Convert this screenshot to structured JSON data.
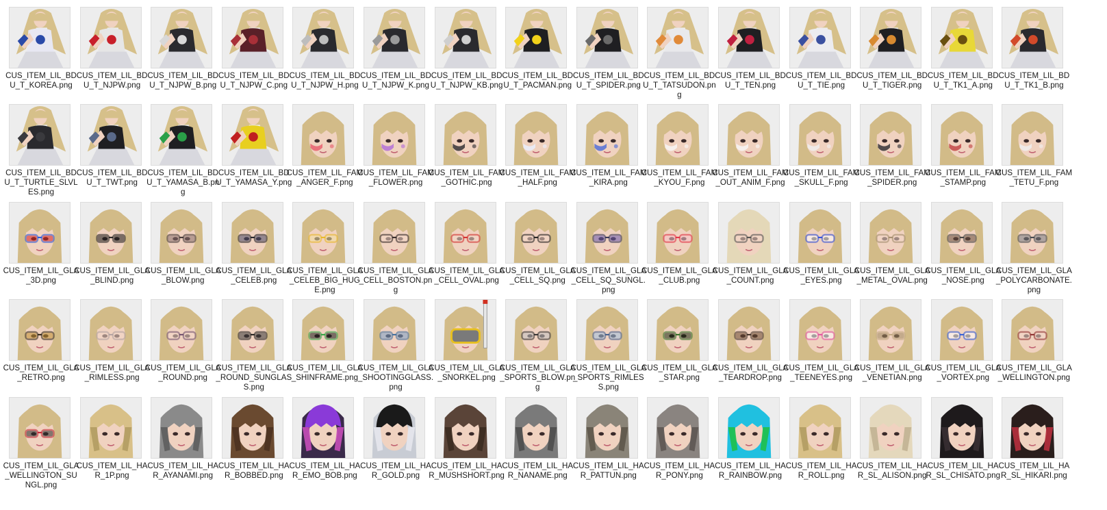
{
  "files": [
    {
      "name": "CUS_ITEM_LIL_BDU_T_KOREA.png",
      "preview": "body",
      "hair": "#d6c08a",
      "item": "#e8e8f2",
      "accent": "#2a4aa8"
    },
    {
      "name": "CUS_ITEM_LIL_BDU_T_NJPW.png",
      "preview": "body",
      "hair": "#d6c08a",
      "item": "#e6e6e6",
      "accent": "#c8202a"
    },
    {
      "name": "CUS_ITEM_LIL_BDU_T_NJPW_B.png",
      "preview": "body",
      "hair": "#d6c08a",
      "item": "#2a2a2e",
      "accent": "#d8d8d8"
    },
    {
      "name": "CUS_ITEM_LIL_BDU_T_NJPW_C.png",
      "preview": "body",
      "hair": "#d6c08a",
      "item": "#5a2028",
      "accent": "#a83038"
    },
    {
      "name": "CUS_ITEM_LIL_BDU_T_NJPW_H.png",
      "preview": "body",
      "hair": "#d6c08a",
      "item": "#2a2a2e",
      "accent": "#bdbdbd"
    },
    {
      "name": "CUS_ITEM_LIL_BDU_T_NJPW_K.png",
      "preview": "body",
      "hair": "#d6c08a",
      "item": "#2a2a2e",
      "accent": "#9a9a9a"
    },
    {
      "name": "CUS_ITEM_LIL_BDU_T_NJPW_KB.png",
      "preview": "body",
      "hair": "#d6c08a",
      "item": "#2a2a2e",
      "accent": "#cfcfcf"
    },
    {
      "name": "CUS_ITEM_LIL_BDU_T_PACMAN.png",
      "preview": "body",
      "hair": "#d6c08a",
      "item": "#1f1f22",
      "accent": "#f2d21a"
    },
    {
      "name": "CUS_ITEM_LIL_BDU_T_SPIDER.png",
      "preview": "body",
      "hair": "#d6c08a",
      "item": "#1f1f22",
      "accent": "#6a6a6a"
    },
    {
      "name": "CUS_ITEM_LIL_BDU_T_TATSUDON.png",
      "preview": "body",
      "hair": "#d6c08a",
      "item": "#e9e9ec",
      "accent": "#e08a3a"
    },
    {
      "name": "CUS_ITEM_LIL_BDU_T_TEN.png",
      "preview": "body",
      "hair": "#d6c08a",
      "item": "#1f1f22",
      "accent": "#c02040"
    },
    {
      "name": "CUS_ITEM_LIL_BDU_T_TIE.png",
      "preview": "body",
      "hair": "#d6c08a",
      "item": "#ececf0",
      "accent": "#3a50a0"
    },
    {
      "name": "CUS_ITEM_LIL_BDU_T_TIGER.png",
      "preview": "body",
      "hair": "#d6c08a",
      "item": "#1f1f22",
      "accent": "#d88a30"
    },
    {
      "name": "CUS_ITEM_LIL_BDU_T_TK1_A.png",
      "preview": "body",
      "hair": "#d6c08a",
      "item": "#e8d838",
      "accent": "#6a5010"
    },
    {
      "name": "CUS_ITEM_LIL_BDU_T_TK1_B.png",
      "preview": "body",
      "hair": "#d6c08a",
      "item": "#2a2a2e",
      "accent": "#d24a2a"
    },
    {
      "name": "CUS_ITEM_LIL_BDU_T_TURTLE_SLVLES.png",
      "preview": "body",
      "hair": "#d6c08a",
      "item": "#2a2a2e",
      "accent": "#3a3a3e"
    },
    {
      "name": "CUS_ITEM_LIL_BDU_T_TWT.png",
      "preview": "body",
      "hair": "#d6c08a",
      "item": "#1f1f22",
      "accent": "#5a6a8a"
    },
    {
      "name": "CUS_ITEM_LIL_BDU_T_YAMASA_B.png",
      "preview": "body",
      "hair": "#d6c08a",
      "item": "#1f1f22",
      "accent": "#2aa048"
    },
    {
      "name": "CUS_ITEM_LIL_BDU_T_YAMASA_Y.png",
      "preview": "body",
      "hair": "#d6c08a",
      "item": "#e8cf20",
      "accent": "#c02020"
    },
    {
      "name": "CUS_ITEM_LIL_FAM_ANGER_F.png",
      "preview": "face",
      "hair": "#d2bb88",
      "item": "#e85a6a",
      "accent": "#f2d6c8"
    },
    {
      "name": "CUS_ITEM_LIL_FAM_FLOWER.png",
      "preview": "face",
      "hair": "#d2bb88",
      "item": "#b06ad8",
      "accent": "#f2d6c8"
    },
    {
      "name": "CUS_ITEM_LIL_FAM_GOTHIC.png",
      "preview": "face",
      "hair": "#d2bb88",
      "item": "#2a2a30",
      "accent": "#f4e8ec"
    },
    {
      "name": "CUS_ITEM_LIL_FAM_HALF.png",
      "preview": "face",
      "hair": "#d2bb88",
      "item": "#e8f0ff",
      "accent": "#4a9ad8"
    },
    {
      "name": "CUS_ITEM_LIL_FAM_KIRA.png",
      "preview": "face",
      "hair": "#d2bb88",
      "item": "#4a6ad8",
      "accent": "#f2d6c8"
    },
    {
      "name": "CUS_ITEM_LIL_FAM_KYOU_F.png",
      "preview": "face",
      "hair": "#d2bb88",
      "item": "#f8f8f8",
      "accent": "#d02030"
    },
    {
      "name": "CUS_ITEM_LIL_FAM_OUT_ANIM_F.png",
      "preview": "face",
      "hair": "#d2bb88",
      "item": "#f8f8f8",
      "accent": "#d03040"
    },
    {
      "name": "CUS_ITEM_LIL_FAM_SKULL_F.png",
      "preview": "face",
      "hair": "#d2bb88",
      "item": "#f0f0f0",
      "accent": "#1a1a1a"
    },
    {
      "name": "CUS_ITEM_LIL_FAM_SPIDER.png",
      "preview": "face",
      "hair": "#d2bb88",
      "item": "#2a2a30",
      "accent": "#f2d6c8"
    },
    {
      "name": "CUS_ITEM_LIL_FAM_STAMP.png",
      "preview": "face",
      "hair": "#d2bb88",
      "item": "#c04040",
      "accent": "#f2d6c8"
    },
    {
      "name": "CUS_ITEM_LIL_FAM_TETU_F.png",
      "preview": "face",
      "hair": "#d2bb88",
      "item": "#f0f0f0",
      "accent": "#e07080"
    },
    {
      "name": "CUS_ITEM_LIL_GLA_3D.png",
      "preview": "glasses",
      "hair": "#d2bb88",
      "item": "#2050d8",
      "accent": "#d82020"
    },
    {
      "name": "CUS_ITEM_LIL_GLA_BLIND.png",
      "preview": "glasses",
      "hair": "#d2bb88",
      "item": "#1a1a1a",
      "accent": "#1a1a1a"
    },
    {
      "name": "CUS_ITEM_LIL_GLA_BLOW.png",
      "preview": "glasses",
      "hair": "#d2bb88",
      "item": "#3a3030",
      "accent": "#8a7070"
    },
    {
      "name": "CUS_ITEM_LIL_GLA_CELEB.png",
      "preview": "glasses",
      "hair": "#d2bb88",
      "item": "#1a1a22",
      "accent": "#4a4a6a"
    },
    {
      "name": "CUS_ITEM_LIL_GLA_CELEB_BIG_HUGE.png",
      "preview": "glasses",
      "hair": "#d2bb88",
      "item": "#e8b820",
      "accent": "#f2e0a0"
    },
    {
      "name": "CUS_ITEM_LIL_GLA_CELL_BOSTON.png",
      "preview": "glasses",
      "hair": "#d2bb88",
      "item": "#2a2020",
      "accent": "#f2d6c8"
    },
    {
      "name": "CUS_ITEM_LIL_GLA_CELL_OVAL.png",
      "preview": "glasses",
      "hair": "#d2bb88",
      "item": "#d02a2a",
      "accent": "#f2d6c8"
    },
    {
      "name": "CUS_ITEM_LIL_GLA_CELL_SQ.png",
      "preview": "glasses",
      "hair": "#d2bb88",
      "item": "#1a1a1a",
      "accent": "#f2d6c8"
    },
    {
      "name": "CUS_ITEM_LIL_GLA_CELL_SQ_SUNGL.png",
      "preview": "glasses",
      "hair": "#d2bb88",
      "item": "#2a2a50",
      "accent": "#6a5ab0"
    },
    {
      "name": "CUS_ITEM_LIL_GLA_CLUB.png",
      "preview": "glasses",
      "hair": "#d2bb88",
      "item": "#e02a40",
      "accent": "#f8c0c8"
    },
    {
      "name": "CUS_ITEM_LIL_GLA_COUNT.png",
      "preview": "glasses",
      "hair": "#e4d8b8",
      "item": "#4a4a4a",
      "accent": "#f2d6c8"
    },
    {
      "name": "CUS_ITEM_LIL_GLA_EYES.png",
      "preview": "glasses",
      "hair": "#d2bb88",
      "item": "#2a4ad8",
      "accent": "#ffffff"
    },
    {
      "name": "CUS_ITEM_LIL_GLA_METAL_OVAL.png",
      "preview": "glasses",
      "hair": "#d2bb88",
      "item": "#a08a6a",
      "accent": "#f2d6c8"
    },
    {
      "name": "CUS_ITEM_LIL_GLA_NOSE.png",
      "preview": "glasses",
      "hair": "#d2bb88",
      "item": "#3a3a3a",
      "accent": "#6a5040"
    },
    {
      "name": "CUS_ITEM_LIL_GLA_POLYCARBONATE.png",
      "preview": "glasses",
      "hair": "#d2bb88",
      "item": "#3a4048",
      "accent": "#7a8088"
    },
    {
      "name": "CUS_ITEM_LIL_GLA_RETRO.png",
      "preview": "glasses",
      "hair": "#d2bb88",
      "item": "#2a2010",
      "accent": "#c09030"
    },
    {
      "name": "CUS_ITEM_LIL_GLA_RIMLESS.png",
      "preview": "glasses",
      "hair": "#d2bb88",
      "item": "#b0a0a0",
      "accent": "#f2d6c8"
    },
    {
      "name": "CUS_ITEM_LIL_GLA_ROUND.png",
      "preview": "glasses",
      "hair": "#d2bb88",
      "item": "#6a4a6a",
      "accent": "#f2d6c8"
    },
    {
      "name": "CUS_ITEM_LIL_GLA_ROUND_SUNGLASS.png",
      "preview": "glasses",
      "hair": "#d2bb88",
      "item": "#1a1a1a",
      "accent": "#3a3a3a"
    },
    {
      "name": "CUS_ITEM_LIL_GLA_SHINFRAME.png",
      "preview": "glasses",
      "hair": "#d2bb88",
      "item": "#2aa040",
      "accent": "#1a1a1a"
    },
    {
      "name": "CUS_ITEM_LIL_GLA_SHOOTINGGLASS.png",
      "preview": "glasses",
      "hair": "#d2bb88",
      "item": "#3a6a9a",
      "accent": "#7aa0c8"
    },
    {
      "name": "CUS_ITEM_LIL_GLA_SNORKEL.png",
      "preview": "snorkel",
      "hair": "#d2bb88",
      "item": "#e8c020",
      "accent": "#d03020"
    },
    {
      "name": "CUS_ITEM_LIL_GLA_SPORTS_BLOW.png",
      "preview": "glasses",
      "hair": "#d2bb88",
      "item": "#2a2a2a",
      "accent": "#c0c0c0"
    },
    {
      "name": "CUS_ITEM_LIL_GLA_SPORTS_RIMLESS.png",
      "preview": "glasses",
      "hair": "#d2bb88",
      "item": "#3a5a8a",
      "accent": "#a0c0e0"
    },
    {
      "name": "CUS_ITEM_LIL_GLA_STAR.png",
      "preview": "glasses",
      "hair": "#d2bb88",
      "item": "#2a6a20",
      "accent": "#1a2a10"
    },
    {
      "name": "CUS_ITEM_LIL_GLA_TEARDROP.png",
      "preview": "glasses",
      "hair": "#d2bb88",
      "item": "#3a2a20",
      "accent": "#6a4a30"
    },
    {
      "name": "CUS_ITEM_LIL_GLA_TEENEYES.png",
      "preview": "glasses",
      "hair": "#d2bb88",
      "item": "#e050a0",
      "accent": "#ffffff"
    },
    {
      "name": "CUS_ITEM_LIL_GLA_VENETIAN.png",
      "preview": "glasses",
      "hair": "#d2bb88",
      "item": "#c0a880",
      "accent": "#a08a60"
    },
    {
      "name": "CUS_ITEM_LIL_GLA_VORTEX.png",
      "preview": "glasses",
      "hair": "#d2bb88",
      "item": "#2a5ad8",
      "accent": "#ffffff"
    },
    {
      "name": "CUS_ITEM_LIL_GLA_WELLINGTON.png",
      "preview": "glasses",
      "hair": "#d2bb88",
      "item": "#8a2a2a",
      "accent": "#f2d6c8"
    },
    {
      "name": "CUS_ITEM_LIL_GLA_WELLINGTON_SUNGL.png",
      "preview": "glasses",
      "hair": "#d2bb88",
      "item": "#c02030",
      "accent": "#2a2a2a"
    },
    {
      "name": "CUS_ITEM_LIL_HAR_1P.png",
      "preview": "hair",
      "hair": "#d8c088",
      "item": "#d8c088",
      "accent": "#b09a60"
    },
    {
      "name": "CUS_ITEM_LIL_HAR_AYANAMI.png",
      "preview": "hair",
      "hair": "#8a8a8a",
      "item": "#8a8a8a",
      "accent": "#5a5a5a"
    },
    {
      "name": "CUS_ITEM_LIL_HAR_BOBBED.png",
      "preview": "hair",
      "hair": "#6a4a30",
      "item": "#6a4a30",
      "accent": "#4a3020"
    },
    {
      "name": "CUS_ITEM_LIL_HAR_EMO_BOB.png",
      "preview": "hair",
      "hair": "#3a2a4a",
      "item": "#8a3ad8",
      "accent": "#d050c0"
    },
    {
      "name": "CUS_ITEM_LIL_HAR_GOLD.png",
      "preview": "hair",
      "hair": "#c8ccd4",
      "item": "#1a1a1a",
      "accent": "#e8e8ee"
    },
    {
      "name": "CUS_ITEM_LIL_HAR_MUSHSHORT.png",
      "preview": "hair",
      "hair": "#5a4438",
      "item": "#5a4438",
      "accent": "#3a2a20"
    },
    {
      "name": "CUS_ITEM_LIL_HAR_NANAME.png",
      "preview": "hair",
      "hair": "#7a7a7a",
      "item": "#7a7a7a",
      "accent": "#4a4a4a"
    },
    {
      "name": "CUS_ITEM_LIL_HAR_PATTUN.png",
      "preview": "hair",
      "hair": "#8a8478",
      "item": "#8a8478",
      "accent": "#5a5448"
    },
    {
      "name": "CUS_ITEM_LIL_HAR_PONY.png",
      "preview": "hair",
      "hair": "#8a8480",
      "item": "#8a8480",
      "accent": "#5a5450"
    },
    {
      "name": "CUS_ITEM_LIL_HAR_RAINBOW.png",
      "preview": "hair",
      "hair": "#20c0e0",
      "item": "#20c0e0",
      "accent": "#20c040"
    },
    {
      "name": "CUS_ITEM_LIL_HAR_ROLL.png",
      "preview": "hair",
      "hair": "#d8c088",
      "item": "#d8c088",
      "accent": "#b09a60"
    },
    {
      "name": "CUS_ITEM_LIL_HAR_SL_ALISON.png",
      "preview": "hair",
      "hair": "#e4d8bc",
      "item": "#e4d8bc",
      "accent": "#c0b090"
    },
    {
      "name": "CUS_ITEM_LIL_HAR_SL_CHISATO.png",
      "preview": "hair",
      "hair": "#1e1a1c",
      "item": "#1e1a1c",
      "accent": "#3a3034"
    },
    {
      "name": "CUS_ITEM_LIL_HAR_SL_HIKARI.png",
      "preview": "hair",
      "hair": "#2a1e1c",
      "item": "#2a1e1c",
      "accent": "#c03040"
    }
  ]
}
